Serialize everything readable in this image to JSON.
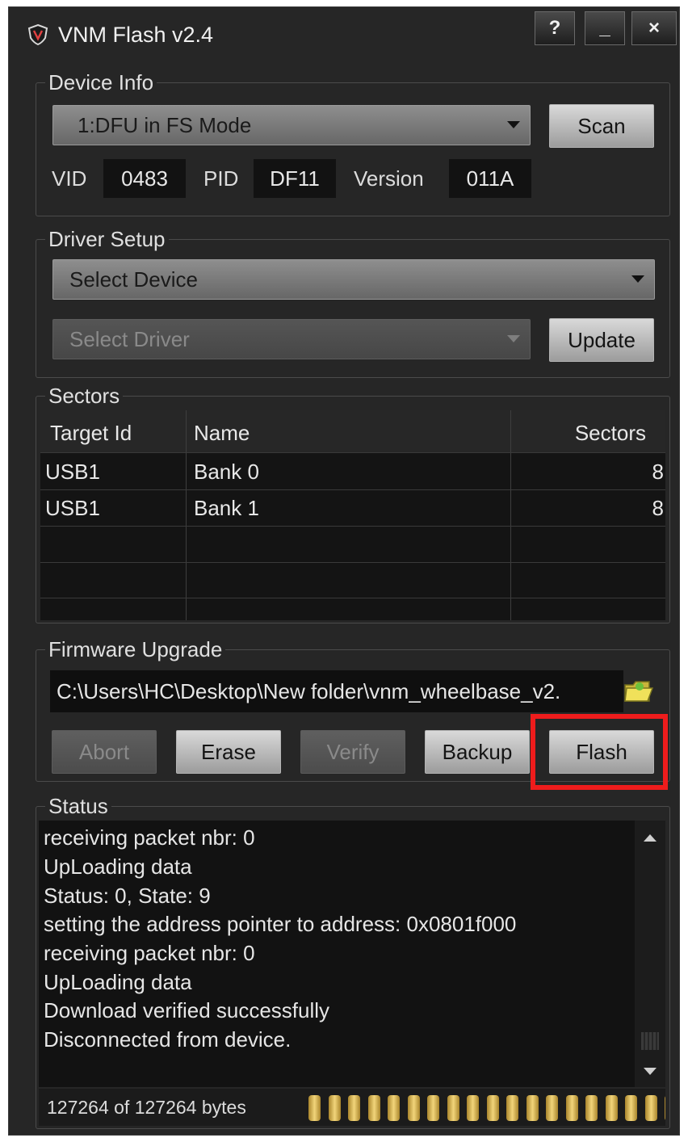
{
  "window": {
    "title": "VNM Flash v2.4",
    "buttons": {
      "help": "?",
      "minimize": "_",
      "close": "×"
    }
  },
  "device_info": {
    "label": "Device Info",
    "device_select": "1:DFU in FS Mode",
    "scan_label": "Scan",
    "vid_label": "VID",
    "vid_value": "0483",
    "pid_label": "PID",
    "pid_value": "DF11",
    "version_label": "Version",
    "version_value": "011A"
  },
  "driver_setup": {
    "label": "Driver Setup",
    "device_select": "Select Device",
    "driver_select": "Select Driver",
    "update_label": "Update"
  },
  "sectors": {
    "label": "Sectors",
    "columns": [
      "Target Id",
      "Name",
      "Sectors"
    ],
    "rows": [
      {
        "target_id": "USB1",
        "name": "Bank 0",
        "sectors": "8"
      },
      {
        "target_id": "USB1",
        "name": "Bank 1",
        "sectors": "8"
      }
    ]
  },
  "firmware": {
    "label": "Firmware Upgrade",
    "file_path": "C:\\Users\\HC\\Desktop\\New folder\\vnm_wheelbase_v2.",
    "buttons": {
      "abort": "Abort",
      "erase": "Erase",
      "verify": "Verify",
      "backup": "Backup",
      "flash": "Flash"
    },
    "highlight_color": "#ee1c1c"
  },
  "status": {
    "label": "Status",
    "log": [
      "receiving packet nbr: 0",
      "UpLoading data",
      "Status: 0, State: 9",
      "setting the address pointer to address: 0x0801f000",
      "receiving packet nbr: 0",
      "UpLoading data",
      "Download verified successfully",
      "Disconnected from device."
    ],
    "progress_text": "127264 of 127264 bytes",
    "progress_fraction": 1.0
  }
}
